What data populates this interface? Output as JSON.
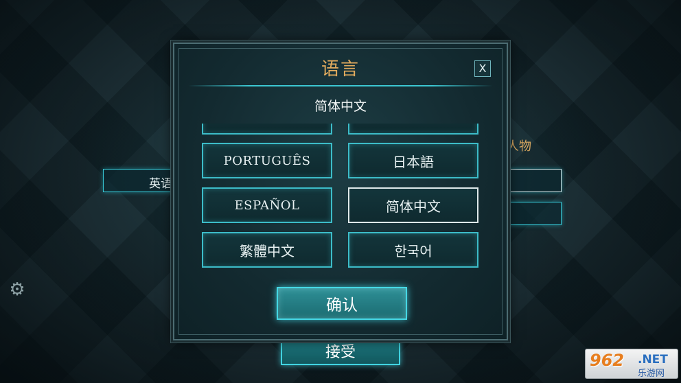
{
  "background": {
    "left_button_label": "英语",
    "right_label": "人物",
    "settings_icon": "gear-icon",
    "accept_label": "接受"
  },
  "dialog": {
    "title": "语言",
    "close_label": "X",
    "current_language": "简体中文",
    "options": [
      {
        "label": "PORTUGUÊS",
        "selected": false
      },
      {
        "label": "日本語",
        "selected": false
      },
      {
        "label": "ESPAÑOL",
        "selected": false
      },
      {
        "label": "简体中文",
        "selected": true
      },
      {
        "label": "繁體中文",
        "selected": false
      },
      {
        "label": "한국어",
        "selected": false
      }
    ],
    "confirm_label": "确认"
  },
  "watermark": {
    "number": "962",
    "domain": ".NET",
    "site": "乐游网"
  },
  "colors": {
    "accent_cyan": "#3cbcc8",
    "title_gold": "#e2ab5e"
  }
}
